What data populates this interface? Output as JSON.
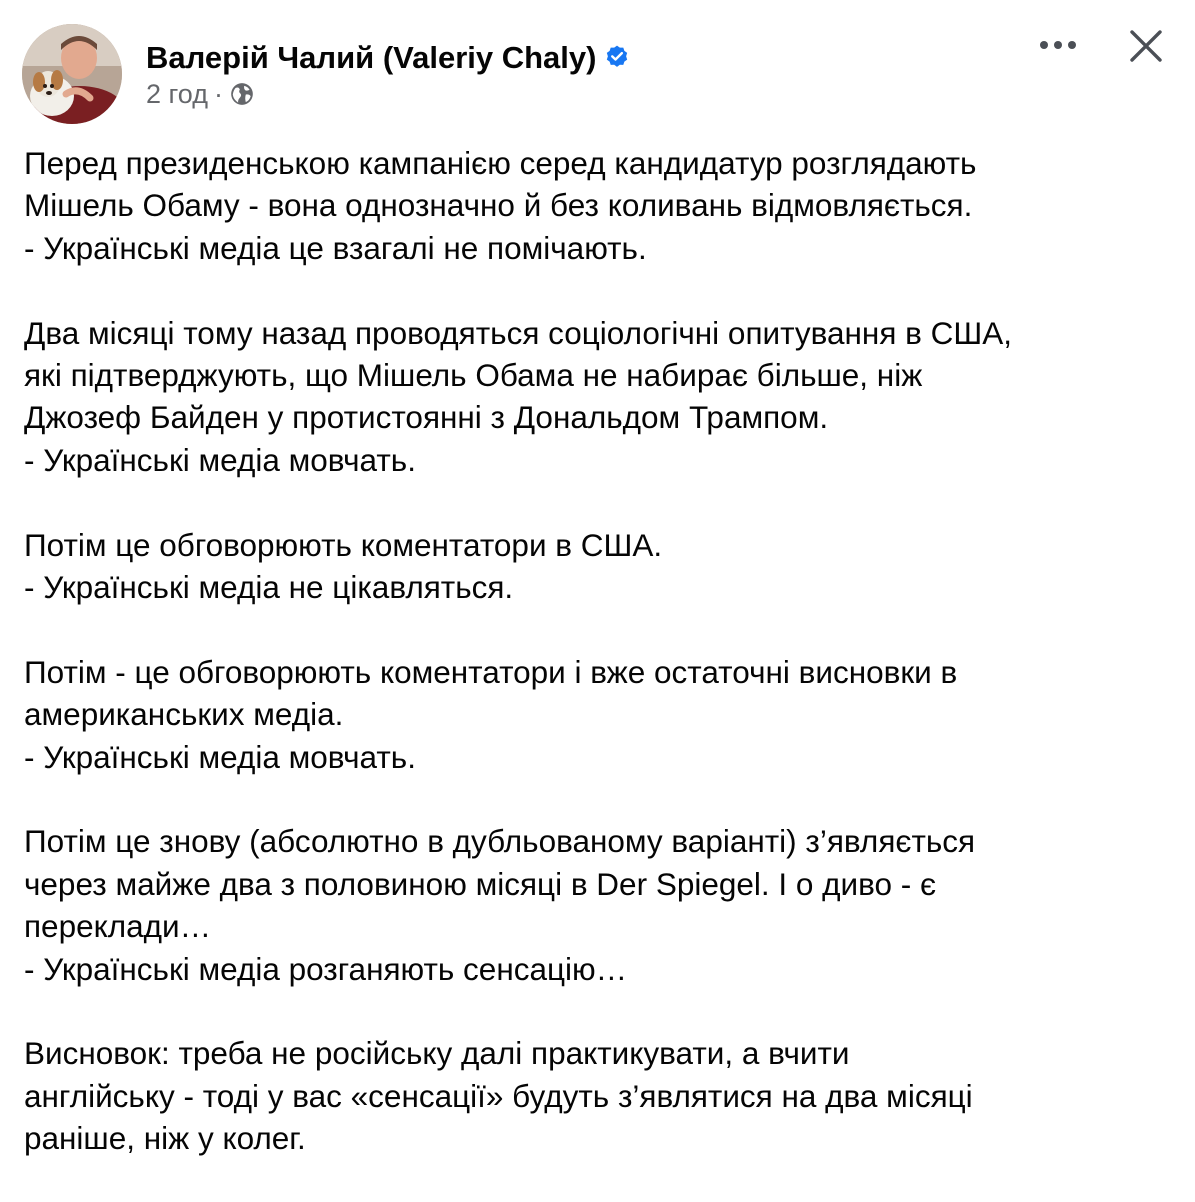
{
  "author": {
    "name": "Валерій Чалий (Valeriy Chaly)",
    "avatar_icon": "avatar-photo",
    "verified_icon": "verified-badge-icon",
    "verified_color": "#1877f2"
  },
  "meta": {
    "time": "2 год",
    "separator": "·",
    "audience_icon": "globe-icon"
  },
  "actions": {
    "more_icon": "more-options-icon",
    "close_icon": "close-icon"
  },
  "colors": {
    "text": "#050505",
    "secondary_text": "#65676b",
    "background": "#ffffff"
  },
  "post": {
    "paragraphs": [
      {
        "lines": [
          "Перед президенською кампанією серед кандидатур розглядають",
          "Мішель Обаму - вона однозначно й без коливань відмовляється.",
          "- Українські медіа це взагалі не помічають."
        ]
      },
      {
        "lines": [
          "Два місяці тому назад проводяться соціологічні опитування в США,",
          "які підтверджують, що Мішель Обама не набирає більше, ніж",
          "Джозеф Байден у протистоянні з Дональдом Трампом.",
          "- Українські медіа мовчать."
        ]
      },
      {
        "lines": [
          "Потім це обговорюють коментатори в США.",
          "- Українські медіа не цікавляться."
        ]
      },
      {
        "lines": [
          "Потім - це обговорюють коментатори і вже остаточні висновки в",
          "американських медіа.",
          "- Українські медіа мовчать."
        ]
      },
      {
        "lines": [
          "Потім це знову (абсолютно в дубльованому варіанті) з’являється",
          "через майже два з половиною місяці в Der Spiegel. І о диво - є",
          "переклади…",
          "- Українські медіа розганяють сенсацію…"
        ]
      },
      {
        "lines": [
          "Висновок: треба не російську далі практикувати, а вчити",
          "англійську - тоді у вас «сенсації» будуть з’являтися на два місяці",
          "раніше, ніж у колег."
        ]
      }
    ]
  }
}
